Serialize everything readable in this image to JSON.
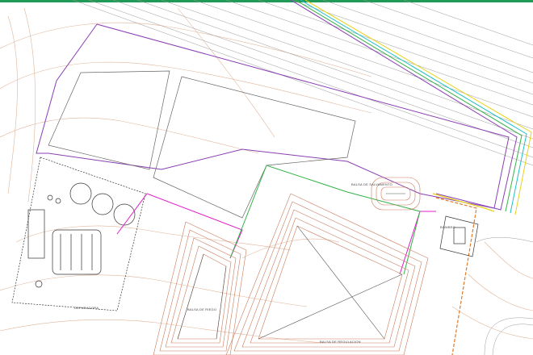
{
  "labels": {
    "depuradora": "DEPURADORA",
    "balsa_riego": "BALSA DE RIEGO",
    "balsa_regulacion": "BALSA DE REGULACION",
    "balsa_salvamento": "BALSA DE SALVAMENTO",
    "bombeo": "BOMBEO"
  },
  "colors": {
    "topbar": "#1f9a57",
    "contour": "#e0b49a",
    "purple_boundary": "#8a3fb3",
    "green_boundary": "#36b24a",
    "magenta_boundary": "#e020c8",
    "orange_dashed": "#e07a2a",
    "yellow_boundary": "#e8d21a",
    "road_lines": "#9a9a9a"
  }
}
